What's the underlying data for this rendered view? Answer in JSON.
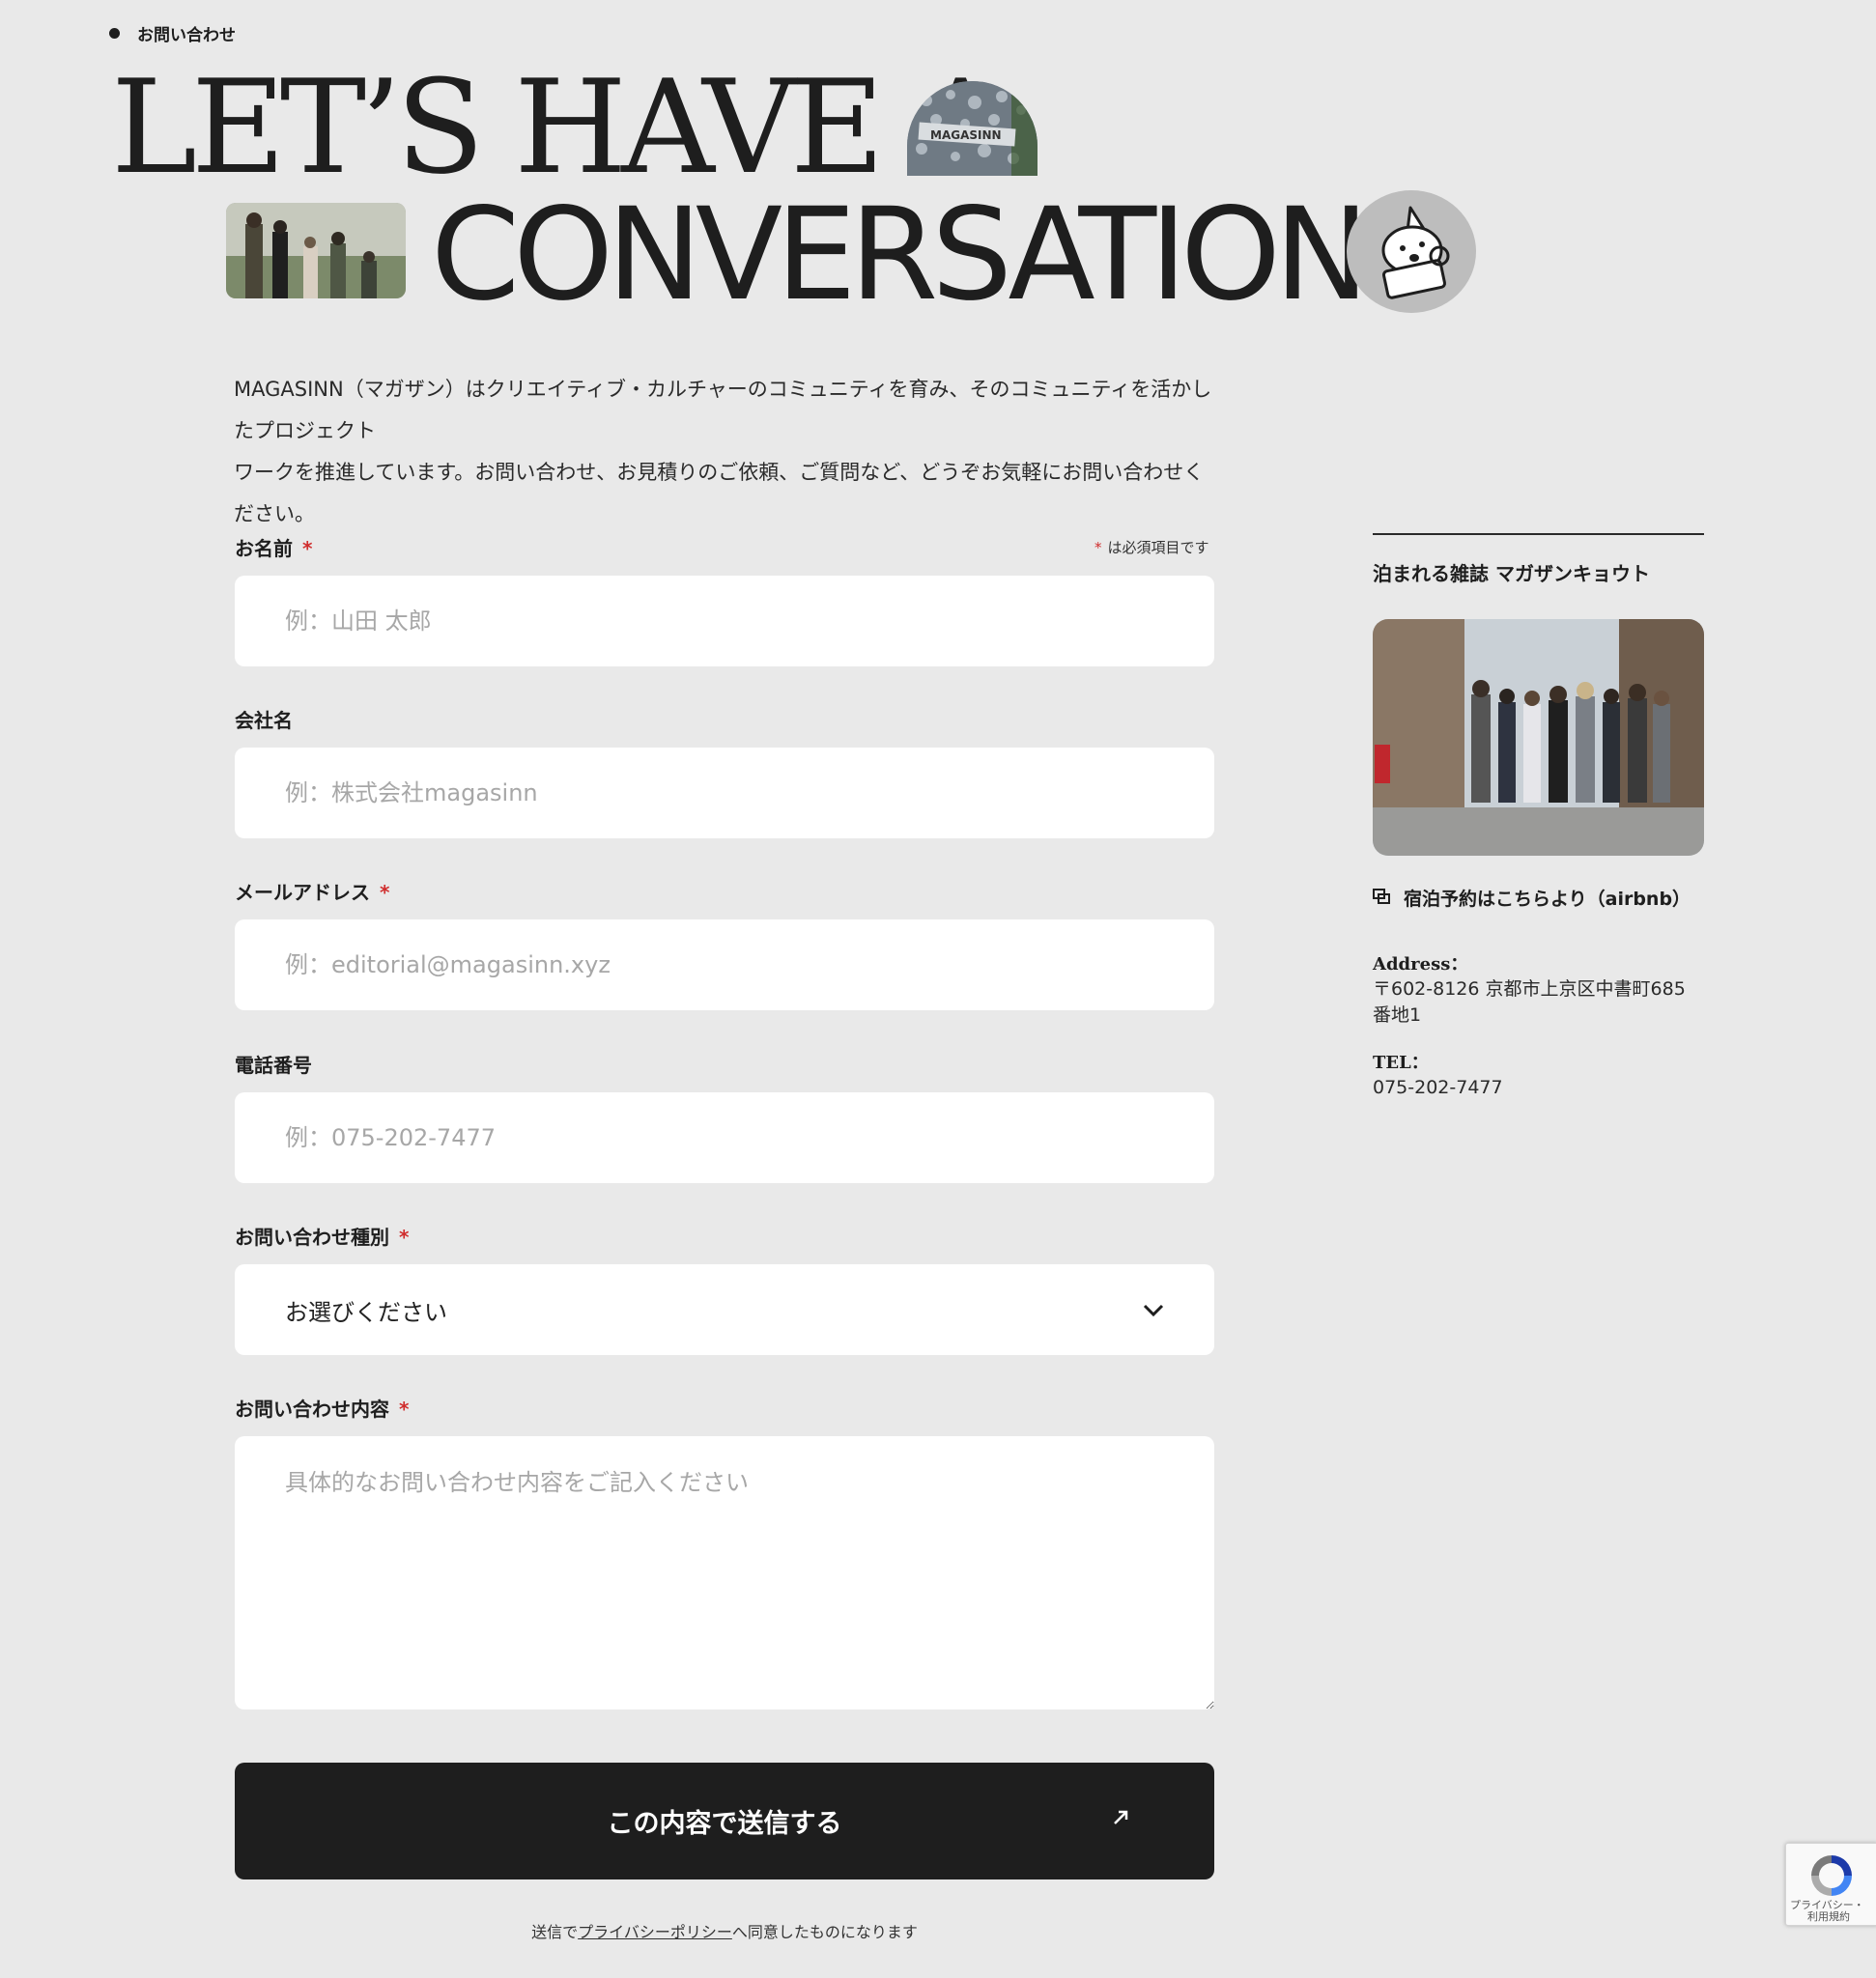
{
  "breadcrumb": {
    "label": "お問い合わせ"
  },
  "hero": {
    "line1": "LET’S HAVE A",
    "line2": "CONVERSATION",
    "arch_photo_text": "MAGASINN"
  },
  "intro": {
    "line1": "MAGASINN（マガザン）はクリエイティブ・カルチャーのコミュニティを育み、そのコミュニティを活かしたプロジェクト",
    "line2": "ワークを推進しています。お問い合わせ、お見積りのご依頼、ご質問など、どうぞお気軽にお問い合わせください。"
  },
  "form": {
    "required_mark": "*",
    "required_note": "は必須項目です",
    "name": {
      "label": "お名前",
      "placeholder": "例：山田 太郎",
      "value": ""
    },
    "company": {
      "label": "会社名",
      "placeholder": "例：株式会社magasinn",
      "value": ""
    },
    "email": {
      "label": "メールアドレス",
      "placeholder": "例：editorial@magasinn.xyz",
      "value": ""
    },
    "phone": {
      "label": "電話番号",
      "placeholder": "例：075-202-7477",
      "value": ""
    },
    "inquiry_type": {
      "label": "お問い合わせ種別",
      "selected": "お選びください"
    },
    "message": {
      "label": "お問い合わせ内容",
      "placeholder": "具体的なお問い合わせ内容をご記入ください",
      "value": ""
    },
    "submit_label": "この内容で送信する",
    "consent_prefix": "送信で",
    "consent_link": "プライバシーポリシー",
    "consent_suffix": "へ同意したものになります"
  },
  "sidebar": {
    "title": "泊まれる雑誌 マガザンキョウト",
    "airbnb_link": "宿泊予約はこちらより（airbnb）",
    "address_label": "Address：",
    "address_line1": "〒602-8126 京都市上京区中書町685",
    "address_line2": "番地1",
    "tel_label": "TEL：",
    "tel_value": "075-202-7477"
  },
  "recaptcha": {
    "line1": "プライバシー・",
    "line2": "利用規約"
  },
  "icons": {
    "bullet": "bullet-dot-icon",
    "chevron": "chevron-down-icon",
    "arrow": "arrow-up-right-icon",
    "external": "external-link-icon",
    "recaptcha": "recaptcha-logo-icon"
  }
}
